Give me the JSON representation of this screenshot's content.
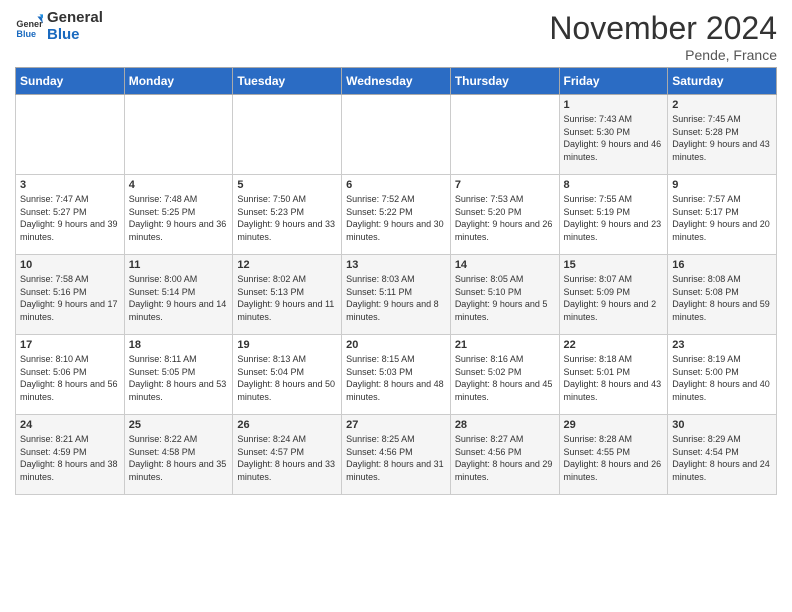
{
  "header": {
    "logo_line1": "General",
    "logo_line2": "Blue",
    "month": "November 2024",
    "location": "Pende, France"
  },
  "days_of_week": [
    "Sunday",
    "Monday",
    "Tuesday",
    "Wednesday",
    "Thursday",
    "Friday",
    "Saturday"
  ],
  "weeks": [
    [
      {
        "day": "",
        "info": ""
      },
      {
        "day": "",
        "info": ""
      },
      {
        "day": "",
        "info": ""
      },
      {
        "day": "",
        "info": ""
      },
      {
        "day": "",
        "info": ""
      },
      {
        "day": "1",
        "info": "Sunrise: 7:43 AM\nSunset: 5:30 PM\nDaylight: 9 hours and 46 minutes."
      },
      {
        "day": "2",
        "info": "Sunrise: 7:45 AM\nSunset: 5:28 PM\nDaylight: 9 hours and 43 minutes."
      }
    ],
    [
      {
        "day": "3",
        "info": "Sunrise: 7:47 AM\nSunset: 5:27 PM\nDaylight: 9 hours and 39 minutes."
      },
      {
        "day": "4",
        "info": "Sunrise: 7:48 AM\nSunset: 5:25 PM\nDaylight: 9 hours and 36 minutes."
      },
      {
        "day": "5",
        "info": "Sunrise: 7:50 AM\nSunset: 5:23 PM\nDaylight: 9 hours and 33 minutes."
      },
      {
        "day": "6",
        "info": "Sunrise: 7:52 AM\nSunset: 5:22 PM\nDaylight: 9 hours and 30 minutes."
      },
      {
        "day": "7",
        "info": "Sunrise: 7:53 AM\nSunset: 5:20 PM\nDaylight: 9 hours and 26 minutes."
      },
      {
        "day": "8",
        "info": "Sunrise: 7:55 AM\nSunset: 5:19 PM\nDaylight: 9 hours and 23 minutes."
      },
      {
        "day": "9",
        "info": "Sunrise: 7:57 AM\nSunset: 5:17 PM\nDaylight: 9 hours and 20 minutes."
      }
    ],
    [
      {
        "day": "10",
        "info": "Sunrise: 7:58 AM\nSunset: 5:16 PM\nDaylight: 9 hours and 17 minutes."
      },
      {
        "day": "11",
        "info": "Sunrise: 8:00 AM\nSunset: 5:14 PM\nDaylight: 9 hours and 14 minutes."
      },
      {
        "day": "12",
        "info": "Sunrise: 8:02 AM\nSunset: 5:13 PM\nDaylight: 9 hours and 11 minutes."
      },
      {
        "day": "13",
        "info": "Sunrise: 8:03 AM\nSunset: 5:11 PM\nDaylight: 9 hours and 8 minutes."
      },
      {
        "day": "14",
        "info": "Sunrise: 8:05 AM\nSunset: 5:10 PM\nDaylight: 9 hours and 5 minutes."
      },
      {
        "day": "15",
        "info": "Sunrise: 8:07 AM\nSunset: 5:09 PM\nDaylight: 9 hours and 2 minutes."
      },
      {
        "day": "16",
        "info": "Sunrise: 8:08 AM\nSunset: 5:08 PM\nDaylight: 8 hours and 59 minutes."
      }
    ],
    [
      {
        "day": "17",
        "info": "Sunrise: 8:10 AM\nSunset: 5:06 PM\nDaylight: 8 hours and 56 minutes."
      },
      {
        "day": "18",
        "info": "Sunrise: 8:11 AM\nSunset: 5:05 PM\nDaylight: 8 hours and 53 minutes."
      },
      {
        "day": "19",
        "info": "Sunrise: 8:13 AM\nSunset: 5:04 PM\nDaylight: 8 hours and 50 minutes."
      },
      {
        "day": "20",
        "info": "Sunrise: 8:15 AM\nSunset: 5:03 PM\nDaylight: 8 hours and 48 minutes."
      },
      {
        "day": "21",
        "info": "Sunrise: 8:16 AM\nSunset: 5:02 PM\nDaylight: 8 hours and 45 minutes."
      },
      {
        "day": "22",
        "info": "Sunrise: 8:18 AM\nSunset: 5:01 PM\nDaylight: 8 hours and 43 minutes."
      },
      {
        "day": "23",
        "info": "Sunrise: 8:19 AM\nSunset: 5:00 PM\nDaylight: 8 hours and 40 minutes."
      }
    ],
    [
      {
        "day": "24",
        "info": "Sunrise: 8:21 AM\nSunset: 4:59 PM\nDaylight: 8 hours and 38 minutes."
      },
      {
        "day": "25",
        "info": "Sunrise: 8:22 AM\nSunset: 4:58 PM\nDaylight: 8 hours and 35 minutes."
      },
      {
        "day": "26",
        "info": "Sunrise: 8:24 AM\nSunset: 4:57 PM\nDaylight: 8 hours and 33 minutes."
      },
      {
        "day": "27",
        "info": "Sunrise: 8:25 AM\nSunset: 4:56 PM\nDaylight: 8 hours and 31 minutes."
      },
      {
        "day": "28",
        "info": "Sunrise: 8:27 AM\nSunset: 4:56 PM\nDaylight: 8 hours and 29 minutes."
      },
      {
        "day": "29",
        "info": "Sunrise: 8:28 AM\nSunset: 4:55 PM\nDaylight: 8 hours and 26 minutes."
      },
      {
        "day": "30",
        "info": "Sunrise: 8:29 AM\nSunset: 4:54 PM\nDaylight: 8 hours and 24 minutes."
      }
    ]
  ]
}
